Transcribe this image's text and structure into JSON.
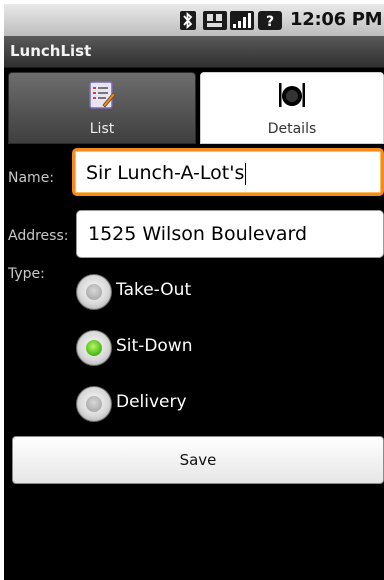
{
  "status_bar": {
    "time": "12:06 PM",
    "icons": [
      "bluetooth-icon",
      "network-icon",
      "signal-icon",
      "alert-icon"
    ]
  },
  "app": {
    "title": "LunchList"
  },
  "tabs": [
    {
      "label": "List",
      "icon": "list-icon",
      "selected": false
    },
    {
      "label": "Details",
      "icon": "restaurant-plate-icon",
      "selected": true
    }
  ],
  "form": {
    "name_label": "Name:",
    "name_value": "Sir Lunch-A-Lot's",
    "address_label": "Address:",
    "address_value": "1525 Wilson Boulevard",
    "type_label": "Type:",
    "type_options": [
      {
        "label": "Take-Out",
        "checked": false
      },
      {
        "label": "Sit-Down",
        "checked": true
      },
      {
        "label": "Delivery",
        "checked": false
      }
    ],
    "save_label": "Save"
  },
  "colors": {
    "focus_border": "#f58a1f",
    "radio_checked": "#5cc521",
    "background": "#000000"
  }
}
